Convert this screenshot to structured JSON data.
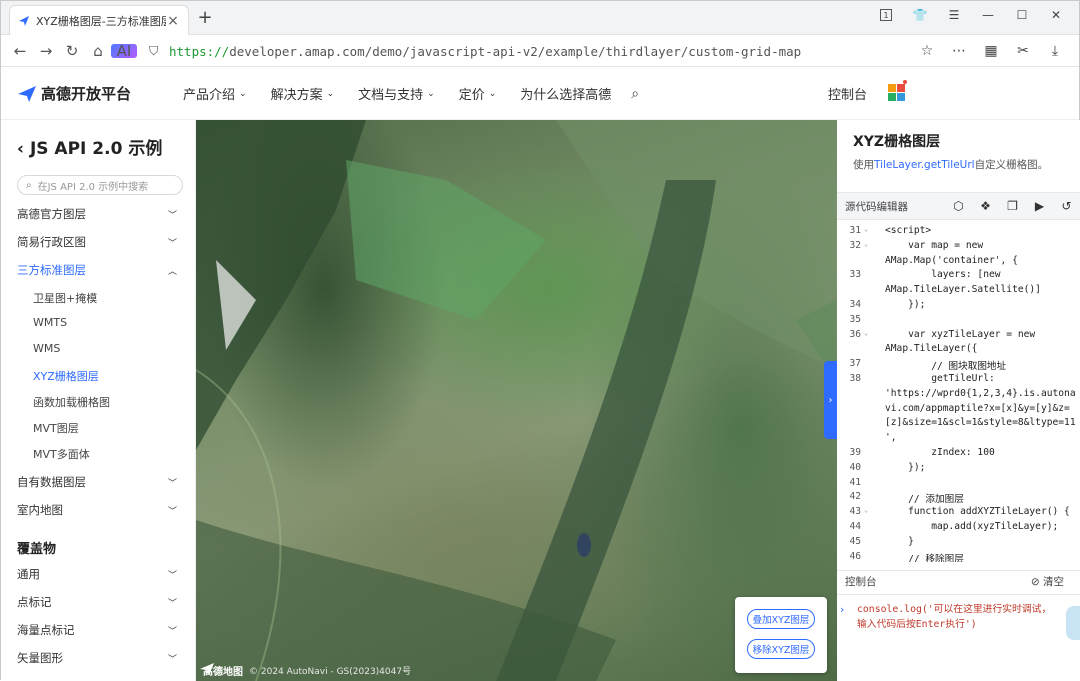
{
  "browser": {
    "tab_title": "XYZ栅格图层-三方标准图层-",
    "tab_close": "×",
    "new_tab": "+",
    "url_scheme": "https://",
    "url_host": "developer.amap.com",
    "url_path": "/demo/javascript-api-v2/example/thirdlayer/custom-grid-map",
    "ai_badge": "AI"
  },
  "site": {
    "brand": "高德开放平台",
    "menu": [
      {
        "label": "产品介绍",
        "has_dropdown": true
      },
      {
        "label": "解决方案",
        "has_dropdown": true
      },
      {
        "label": "文档与支持",
        "has_dropdown": true
      },
      {
        "label": "定价",
        "has_dropdown": true
      },
      {
        "label": "为什么选择高德",
        "has_dropdown": false
      }
    ],
    "console": "控制台"
  },
  "sidebar": {
    "title": "JS API 2.0 示例",
    "search_placeholder": "在JS API 2.0 示例中搜索",
    "sections": [
      {
        "label": "高德官方图层"
      },
      {
        "label": "简易行政区图"
      },
      {
        "label": "三方标准图层",
        "expanded": true,
        "active": true
      }
    ],
    "subitems": [
      {
        "label": "卫星图+掩模"
      },
      {
        "label": "WMTS"
      },
      {
        "label": "WMS"
      },
      {
        "label": "XYZ栅格图层",
        "active": true
      },
      {
        "label": "函数加载栅格图"
      },
      {
        "label": "MVT图层"
      },
      {
        "label": "MVT多面体"
      }
    ],
    "sections2": [
      {
        "label": "自有数据图层"
      },
      {
        "label": "室内地图"
      }
    ],
    "group_title": "覆盖物",
    "group_items": [
      {
        "label": "通用"
      },
      {
        "label": "点标记"
      },
      {
        "label": "海量点标记"
      },
      {
        "label": "矢量图形"
      }
    ]
  },
  "map": {
    "buttons": [
      "叠加XYZ图层",
      "移除XYZ图层"
    ],
    "logo_text": "高德地图",
    "copyright": "© 2024 AutoNavi - GS(2023)4047号",
    "collapse_glyph": "›"
  },
  "panel": {
    "title": "XYZ栅格图层",
    "desc_prefix": "使用",
    "desc_link": "TileLayer.getTileUrl",
    "desc_suffix": "自定义栅格图。",
    "editor_label": "源代码编辑器",
    "code_lines": [
      {
        "n": "31",
        "fold": true,
        "text": "<script>",
        "cls": "k"
      },
      {
        "n": "32",
        "fold": true,
        "text": "    var map = new",
        "cls": ""
      },
      {
        "n": "",
        "fold": false,
        "text": "AMap.Map('container', {",
        "cls": ""
      },
      {
        "n": "33",
        "fold": false,
        "text": "        layers: [new",
        "cls": ""
      },
      {
        "n": "",
        "fold": false,
        "text": "AMap.TileLayer.Satellite()]",
        "cls": ""
      },
      {
        "n": "34",
        "fold": false,
        "text": "    });",
        "cls": ""
      },
      {
        "n": "35",
        "fold": false,
        "text": "",
        "cls": ""
      },
      {
        "n": "36",
        "fold": true,
        "text": "    var xyzTileLayer = new",
        "cls": ""
      },
      {
        "n": "",
        "fold": false,
        "text": "AMap.TileLayer({",
        "cls": ""
      },
      {
        "n": "37",
        "fold": false,
        "text": "        // 图块取图地址",
        "cls": "cm"
      },
      {
        "n": "38",
        "fold": false,
        "text": "        getTileUrl:",
        "cls": ""
      },
      {
        "n": "",
        "fold": false,
        "text": "'https://wprd0{1,2,3,4}.is.autona",
        "cls": "s"
      },
      {
        "n": "",
        "fold": false,
        "text": "vi.com/appmaptile?x=[x]&y=[y]&z=",
        "cls": "s"
      },
      {
        "n": "",
        "fold": false,
        "text": "[z]&size=1&scl=1&style=8&ltype=11",
        "cls": "s"
      },
      {
        "n": "",
        "fold": false,
        "text": "',",
        "cls": "s"
      },
      {
        "n": "39",
        "fold": false,
        "text": "        zIndex: 100",
        "cls": ""
      },
      {
        "n": "40",
        "fold": false,
        "text": "    });",
        "cls": ""
      },
      {
        "n": "41",
        "fold": false,
        "text": "",
        "cls": ""
      },
      {
        "n": "42",
        "fold": false,
        "text": "    // 添加图层",
        "cls": "cm"
      },
      {
        "n": "43",
        "fold": true,
        "text": "    function addXYZTileLayer() {",
        "cls": ""
      },
      {
        "n": "44",
        "fold": false,
        "text": "        map.add(xyzTileLayer);",
        "cls": ""
      },
      {
        "n": "45",
        "fold": false,
        "text": "    }",
        "cls": ""
      },
      {
        "n": "46",
        "fold": false,
        "text": "    // 移除图层",
        "cls": "cm"
      }
    ],
    "console_label": "控制台",
    "console_clear": "清空",
    "console_lines": [
      "console.log('可以在这里进行实时调试，",
      "输入代码后按Enter执行')"
    ]
  },
  "colors": {
    "accent": "#2f6bff",
    "https_green": "#1a9a32"
  }
}
